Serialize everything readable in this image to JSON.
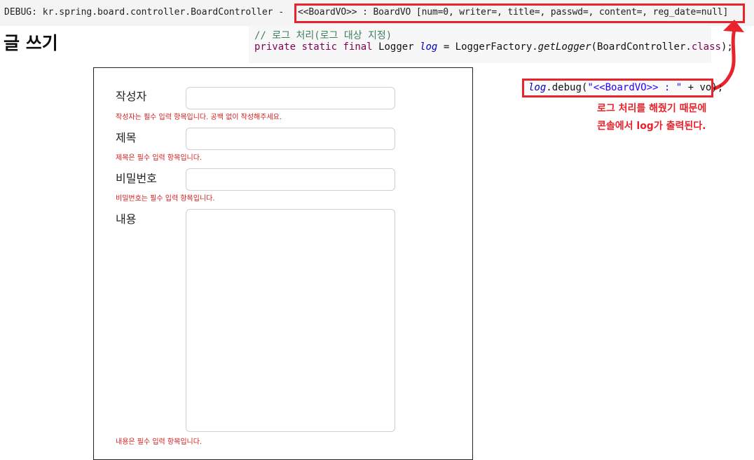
{
  "console": {
    "prefix": "DEBUG: kr.spring.board.controller.BoardController -",
    "highlighted": "<<BoardVO>> : BoardVO [num=0, writer=, title=, passwd=, content=, reg_date=null]"
  },
  "page": {
    "title": "글 쓰기"
  },
  "code": {
    "comment": "// 로그 처리(로그 대상 지정)",
    "kw_private": "private",
    "kw_static": "static",
    "kw_final": "final",
    "type": "Logger",
    "var": "log",
    "assign": "= LoggerFactory.",
    "method": "getLogger",
    "arg_open": "(BoardController.",
    "kw_class": "class",
    "arg_close": ");"
  },
  "log_snippet": {
    "var": "log",
    "call": ".debug(",
    "string": "\"<<BoardVO>> : \"",
    "rest": " + vo);"
  },
  "annotation": {
    "line1": "로그 처리를 해줬기 때문에",
    "line2": "콘솔에서 log가 출력된다."
  },
  "form": {
    "fields": [
      {
        "label": "작성자",
        "value": "",
        "error": "작성자는 필수 입력 항목입니다. 공백 없이 작성해주세요."
      },
      {
        "label": "제목",
        "value": "",
        "error": "제목은 필수 입력 항목입니다."
      },
      {
        "label": "비밀번호",
        "value": "",
        "error": "비밀번호는 필수 입력 항목입니다."
      },
      {
        "label": "내용",
        "value": "",
        "error": "내용은 필수 입력 항목입니다."
      }
    ]
  },
  "colors": {
    "accent_red": "#e8232c",
    "error_red": "#d61b1b",
    "comment_green": "#3f7f5f",
    "keyword_purple": "#7f0055",
    "field_blue": "#0000c0"
  }
}
